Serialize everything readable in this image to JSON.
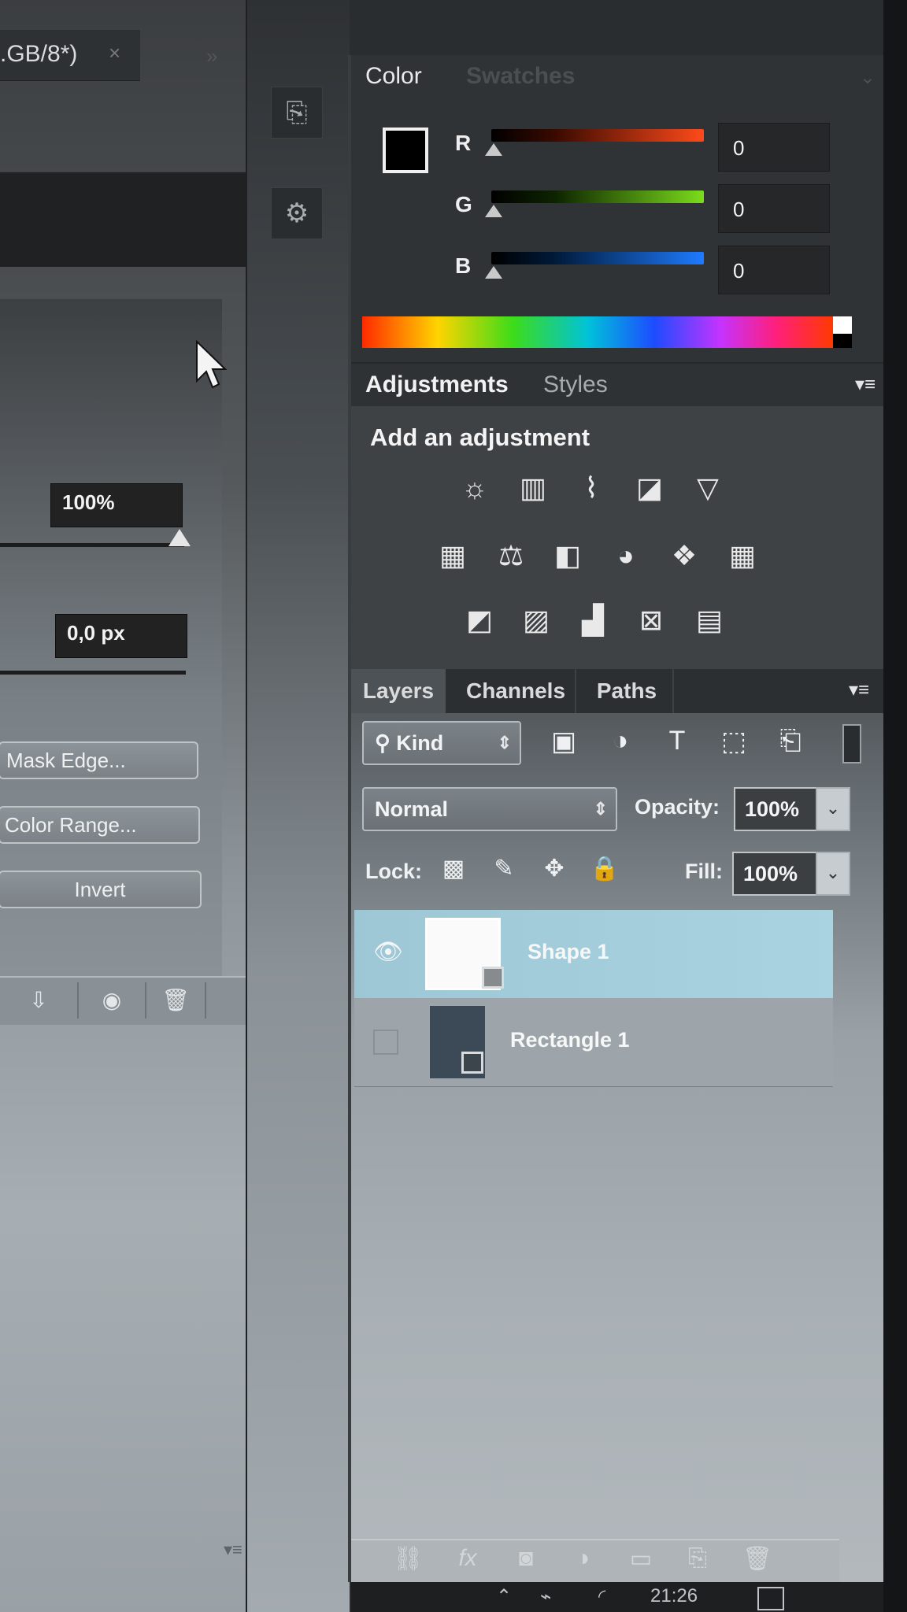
{
  "document": {
    "tab_title": ".GB/8*)",
    "close_glyph": "×"
  },
  "properties": {
    "density_value": "100%",
    "feather_value": "0,0 px",
    "buttons": {
      "mask_edge": "Mask Edge...",
      "color_range": "Color Range...",
      "invert": "Invert"
    }
  },
  "color_panel": {
    "tabs": [
      "Color",
      "Swatches"
    ],
    "channels": [
      {
        "label": "R",
        "value": "0",
        "color": "#ff4a1a"
      },
      {
        "label": "G",
        "value": "0",
        "color": "#7bdc1c"
      },
      {
        "label": "B",
        "value": "0",
        "color": "#1e7bff"
      }
    ]
  },
  "adjustments_panel": {
    "tabs": [
      "Adjustments",
      "Styles"
    ],
    "heading": "Add an adjustment"
  },
  "layers_panel": {
    "tabs": [
      "Layers",
      "Channels",
      "Paths"
    ],
    "filter_kind": "Kind",
    "blend_mode": "Normal",
    "opacity_label": "Opacity:",
    "opacity_value": "100%",
    "lock_label": "Lock:",
    "fill_label": "Fill:",
    "fill_value": "100%",
    "layers": [
      {
        "name": "Shape 1",
        "visible": true,
        "selected": true
      },
      {
        "name": "Rectangle 1",
        "visible": false,
        "selected": false
      }
    ],
    "footer_icons": [
      "link-icon",
      "fx-icon",
      "mask-icon",
      "adjustment-icon",
      "folder-icon",
      "new-layer-icon",
      "trash-icon"
    ],
    "fx_label": "fx"
  },
  "taskbar": {
    "time": "21:26"
  }
}
